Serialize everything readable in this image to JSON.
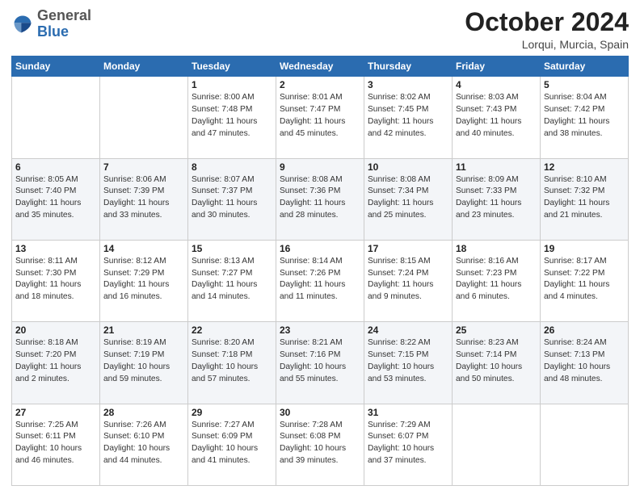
{
  "header": {
    "logo": {
      "general": "General",
      "blue": "Blue"
    },
    "month": "October 2024",
    "location": "Lorqui, Murcia, Spain"
  },
  "weekdays": [
    "Sunday",
    "Monday",
    "Tuesday",
    "Wednesday",
    "Thursday",
    "Friday",
    "Saturday"
  ],
  "weeks": [
    {
      "alt": false,
      "days": [
        null,
        null,
        {
          "num": "1",
          "sunrise": "Sunrise: 8:00 AM",
          "sunset": "Sunset: 7:48 PM",
          "daylight": "Daylight: 11 hours and 47 minutes."
        },
        {
          "num": "2",
          "sunrise": "Sunrise: 8:01 AM",
          "sunset": "Sunset: 7:47 PM",
          "daylight": "Daylight: 11 hours and 45 minutes."
        },
        {
          "num": "3",
          "sunrise": "Sunrise: 8:02 AM",
          "sunset": "Sunset: 7:45 PM",
          "daylight": "Daylight: 11 hours and 42 minutes."
        },
        {
          "num": "4",
          "sunrise": "Sunrise: 8:03 AM",
          "sunset": "Sunset: 7:43 PM",
          "daylight": "Daylight: 11 hours and 40 minutes."
        },
        {
          "num": "5",
          "sunrise": "Sunrise: 8:04 AM",
          "sunset": "Sunset: 7:42 PM",
          "daylight": "Daylight: 11 hours and 38 minutes."
        }
      ]
    },
    {
      "alt": true,
      "days": [
        {
          "num": "6",
          "sunrise": "Sunrise: 8:05 AM",
          "sunset": "Sunset: 7:40 PM",
          "daylight": "Daylight: 11 hours and 35 minutes."
        },
        {
          "num": "7",
          "sunrise": "Sunrise: 8:06 AM",
          "sunset": "Sunset: 7:39 PM",
          "daylight": "Daylight: 11 hours and 33 minutes."
        },
        {
          "num": "8",
          "sunrise": "Sunrise: 8:07 AM",
          "sunset": "Sunset: 7:37 PM",
          "daylight": "Daylight: 11 hours and 30 minutes."
        },
        {
          "num": "9",
          "sunrise": "Sunrise: 8:08 AM",
          "sunset": "Sunset: 7:36 PM",
          "daylight": "Daylight: 11 hours and 28 minutes."
        },
        {
          "num": "10",
          "sunrise": "Sunrise: 8:08 AM",
          "sunset": "Sunset: 7:34 PM",
          "daylight": "Daylight: 11 hours and 25 minutes."
        },
        {
          "num": "11",
          "sunrise": "Sunrise: 8:09 AM",
          "sunset": "Sunset: 7:33 PM",
          "daylight": "Daylight: 11 hours and 23 minutes."
        },
        {
          "num": "12",
          "sunrise": "Sunrise: 8:10 AM",
          "sunset": "Sunset: 7:32 PM",
          "daylight": "Daylight: 11 hours and 21 minutes."
        }
      ]
    },
    {
      "alt": false,
      "days": [
        {
          "num": "13",
          "sunrise": "Sunrise: 8:11 AM",
          "sunset": "Sunset: 7:30 PM",
          "daylight": "Daylight: 11 hours and 18 minutes."
        },
        {
          "num": "14",
          "sunrise": "Sunrise: 8:12 AM",
          "sunset": "Sunset: 7:29 PM",
          "daylight": "Daylight: 11 hours and 16 minutes."
        },
        {
          "num": "15",
          "sunrise": "Sunrise: 8:13 AM",
          "sunset": "Sunset: 7:27 PM",
          "daylight": "Daylight: 11 hours and 14 minutes."
        },
        {
          "num": "16",
          "sunrise": "Sunrise: 8:14 AM",
          "sunset": "Sunset: 7:26 PM",
          "daylight": "Daylight: 11 hours and 11 minutes."
        },
        {
          "num": "17",
          "sunrise": "Sunrise: 8:15 AM",
          "sunset": "Sunset: 7:24 PM",
          "daylight": "Daylight: 11 hours and 9 minutes."
        },
        {
          "num": "18",
          "sunrise": "Sunrise: 8:16 AM",
          "sunset": "Sunset: 7:23 PM",
          "daylight": "Daylight: 11 hours and 6 minutes."
        },
        {
          "num": "19",
          "sunrise": "Sunrise: 8:17 AM",
          "sunset": "Sunset: 7:22 PM",
          "daylight": "Daylight: 11 hours and 4 minutes."
        }
      ]
    },
    {
      "alt": true,
      "days": [
        {
          "num": "20",
          "sunrise": "Sunrise: 8:18 AM",
          "sunset": "Sunset: 7:20 PM",
          "daylight": "Daylight: 11 hours and 2 minutes."
        },
        {
          "num": "21",
          "sunrise": "Sunrise: 8:19 AM",
          "sunset": "Sunset: 7:19 PM",
          "daylight": "Daylight: 10 hours and 59 minutes."
        },
        {
          "num": "22",
          "sunrise": "Sunrise: 8:20 AM",
          "sunset": "Sunset: 7:18 PM",
          "daylight": "Daylight: 10 hours and 57 minutes."
        },
        {
          "num": "23",
          "sunrise": "Sunrise: 8:21 AM",
          "sunset": "Sunset: 7:16 PM",
          "daylight": "Daylight: 10 hours and 55 minutes."
        },
        {
          "num": "24",
          "sunrise": "Sunrise: 8:22 AM",
          "sunset": "Sunset: 7:15 PM",
          "daylight": "Daylight: 10 hours and 53 minutes."
        },
        {
          "num": "25",
          "sunrise": "Sunrise: 8:23 AM",
          "sunset": "Sunset: 7:14 PM",
          "daylight": "Daylight: 10 hours and 50 minutes."
        },
        {
          "num": "26",
          "sunrise": "Sunrise: 8:24 AM",
          "sunset": "Sunset: 7:13 PM",
          "daylight": "Daylight: 10 hours and 48 minutes."
        }
      ]
    },
    {
      "alt": false,
      "days": [
        {
          "num": "27",
          "sunrise": "Sunrise: 7:25 AM",
          "sunset": "Sunset: 6:11 PM",
          "daylight": "Daylight: 10 hours and 46 minutes."
        },
        {
          "num": "28",
          "sunrise": "Sunrise: 7:26 AM",
          "sunset": "Sunset: 6:10 PM",
          "daylight": "Daylight: 10 hours and 44 minutes."
        },
        {
          "num": "29",
          "sunrise": "Sunrise: 7:27 AM",
          "sunset": "Sunset: 6:09 PM",
          "daylight": "Daylight: 10 hours and 41 minutes."
        },
        {
          "num": "30",
          "sunrise": "Sunrise: 7:28 AM",
          "sunset": "Sunset: 6:08 PM",
          "daylight": "Daylight: 10 hours and 39 minutes."
        },
        {
          "num": "31",
          "sunrise": "Sunrise: 7:29 AM",
          "sunset": "Sunset: 6:07 PM",
          "daylight": "Daylight: 10 hours and 37 minutes."
        },
        null,
        null
      ]
    }
  ]
}
